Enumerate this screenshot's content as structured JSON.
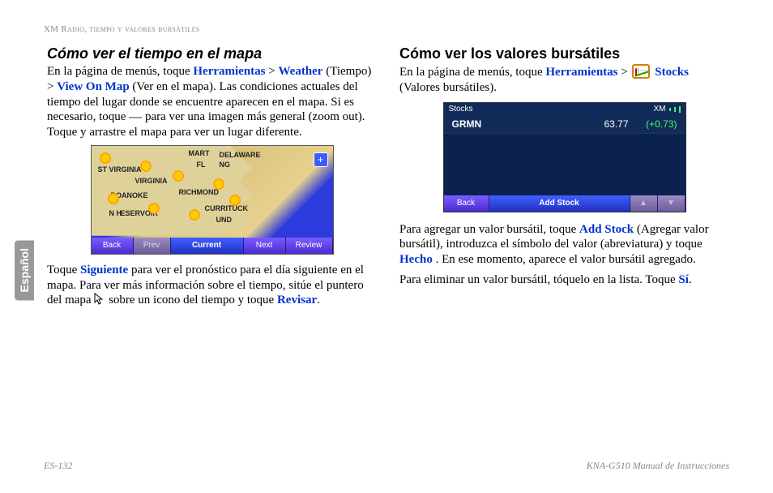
{
  "header": "XM Radio, tiempo y valores bursátiles",
  "lang_tab": "Español",
  "footer": {
    "left": "ES-132",
    "right": "KNA-G510 Manual de Instrucciones"
  },
  "left": {
    "title": "Cómo ver el tiempo en el mapa",
    "p1a": "En la página de menús, toque ",
    "tools": "Herramientas",
    "gt": " > ",
    "weather": "Weather",
    "p1b": " (Tiempo) > ",
    "viewonmap": "View On Map",
    "p1c": " (Ver en el mapa). Las condiciones actuales del tiempo del lugar donde se encuentre aparecen en el mapa. Si es necesario, toque ",
    "p1d": " para ver una imagen más general (zoom out). Toque y arrastre el mapa para ver un lugar diferente.",
    "p2a": "Toque ",
    "siguiente": "Siguiente",
    "p2b": " para ver el pronóstico para el día siguiente en el mapa. Para ver más información sobre el tiempo, sitúe el puntero del mapa ",
    "p2c": " sobre un icono del tiempo y toque ",
    "revisar": "Revisar",
    "period": ".",
    "map_labels": {
      "wv": "ST VIRGINIA",
      "va": "VIRGINIA",
      "de": "DELAWARE",
      "mart": "MART",
      "fl": "FL",
      "ng": "NG",
      "roanoke": "ROANOKE",
      "richmond": "RICHMOND",
      "currituck": "CURRITUCK",
      "nh": "N H",
      "eservoir": "ESERVOIR",
      "und": "UND"
    },
    "toolbar": {
      "back": "Back",
      "prev": "Prev",
      "current": "Current",
      "next": "Next",
      "review": "Review"
    },
    "zoom": "+"
  },
  "right": {
    "title": "Cómo ver los valores bursátiles",
    "p1a": "En la página de menús, toque ",
    "tools": "Herramientas",
    "gt": " > ",
    "stocks": "Stocks",
    "p1b": " (Valores bursátiles).",
    "p2a": "Para agregar un valor bursátil, toque ",
    "addstock": "Add Stock",
    "p2b": " (Agregar valor bursátil), introduzca el símbolo del valor (abreviatura) y toque ",
    "hecho": "Hecho",
    "p2c": ". En ese momento, aparece el valor bursátil agregado.",
    "p3a": "Para eliminar un valor bursátil, tóquelo en la lista. Toque ",
    "si": "Sí",
    "period": ".",
    "screen": {
      "title": "Stocks",
      "xm": "XM",
      "row": {
        "sym": "GRMN",
        "price": "63.77",
        "chg": "(+0.73)"
      },
      "toolbar": {
        "back": "Back",
        "add": "Add Stock",
        "up": "▲",
        "down": "▼"
      }
    }
  }
}
